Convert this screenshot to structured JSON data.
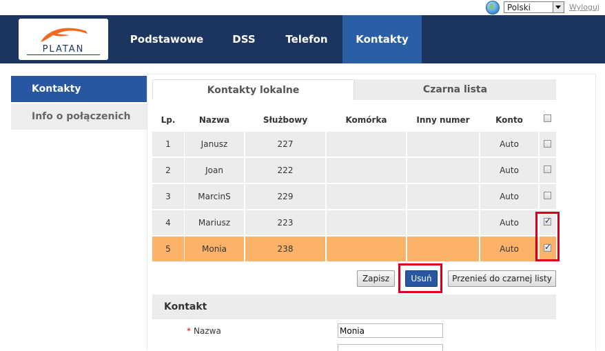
{
  "top": {
    "language": "Polski",
    "logout": "Wyloguj"
  },
  "logo": {
    "text": "PLATAN"
  },
  "nav": {
    "items": [
      {
        "label": "Podstawowe"
      },
      {
        "label": "DSS"
      },
      {
        "label": "Telefon"
      },
      {
        "label": "Kontakty",
        "active": true
      }
    ]
  },
  "sidebar": {
    "items": [
      {
        "label": "Kontakty",
        "active": true
      },
      {
        "label": "Info o połączenich"
      }
    ]
  },
  "tabs": [
    {
      "label": "Kontakty lokalne",
      "active": true
    },
    {
      "label": "Czarna lista"
    }
  ],
  "table": {
    "columns": [
      "Lp.",
      "Nazwa",
      "Służbowy",
      "Komórka",
      "Inny numer",
      "Konto"
    ],
    "rows": [
      {
        "lp": "1",
        "nazwa": "Janusz",
        "sluzbowy": "227",
        "komorka": "",
        "inny": "",
        "konto": "Auto",
        "checked": false
      },
      {
        "lp": "2",
        "nazwa": "Joan",
        "sluzbowy": "222",
        "komorka": "",
        "inny": "",
        "konto": "Auto",
        "checked": false
      },
      {
        "lp": "3",
        "nazwa": "MarcinS",
        "sluzbowy": "229",
        "komorka": "",
        "inny": "",
        "konto": "Auto",
        "checked": false
      },
      {
        "lp": "4",
        "nazwa": "Mariusz",
        "sluzbowy": "223",
        "komorka": "",
        "inny": "",
        "konto": "Auto",
        "checked": true
      },
      {
        "lp": "5",
        "nazwa": "Monia",
        "sluzbowy": "238",
        "komorka": "",
        "inny": "",
        "konto": "Auto",
        "checked": true,
        "highlighted": true
      }
    ]
  },
  "buttons": {
    "save": "Zapisz",
    "delete": "Usuń",
    "move_to_blacklist": "Przenieś do czarnej listy"
  },
  "contact_form": {
    "title": "Kontakt",
    "name_label": "Nazwa",
    "name_required_mark": "*",
    "name_value": "Monia"
  },
  "colors": {
    "header_bg": "#1b3560",
    "accent": "#2856a0",
    "highlight_row": "#fbb36a",
    "annotation": "#d6001c"
  }
}
